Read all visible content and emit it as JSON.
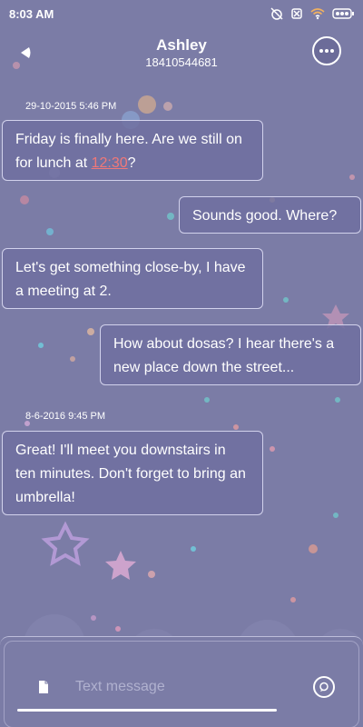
{
  "status_bar": {
    "time": "8:03 AM",
    "icons": [
      "alarm-off-icon",
      "sim-off-icon",
      "wifi-icon",
      "battery-icon"
    ]
  },
  "header": {
    "contact_name": "Ashley",
    "contact_number": "18410544681"
  },
  "conversation": {
    "timestamps": [
      "29-10-2015 5:46 PM",
      "8-6-2016 9:45 PM"
    ],
    "messages": [
      {
        "direction": "incoming",
        "text_before": "Friday is finally here. Are we still on for lunch at ",
        "link": "12:30",
        "text_after": "?"
      },
      {
        "direction": "outgoing",
        "text": "Sounds good. Where?"
      },
      {
        "direction": "incoming",
        "text": "Let's get something close-by, I have a meeting at 2."
      },
      {
        "direction": "outgoing",
        "text": "How about dosas? I hear there's a new place down the street..."
      },
      {
        "direction": "incoming",
        "text": "Great! I'll meet you downstairs in ten minutes. Don't forget to bring an umbrella!"
      }
    ]
  },
  "composer": {
    "placeholder": "Text message",
    "value": ""
  },
  "colors": {
    "background": "#7b7ca6",
    "bubble": "#7070a0",
    "link": "#f07878"
  }
}
